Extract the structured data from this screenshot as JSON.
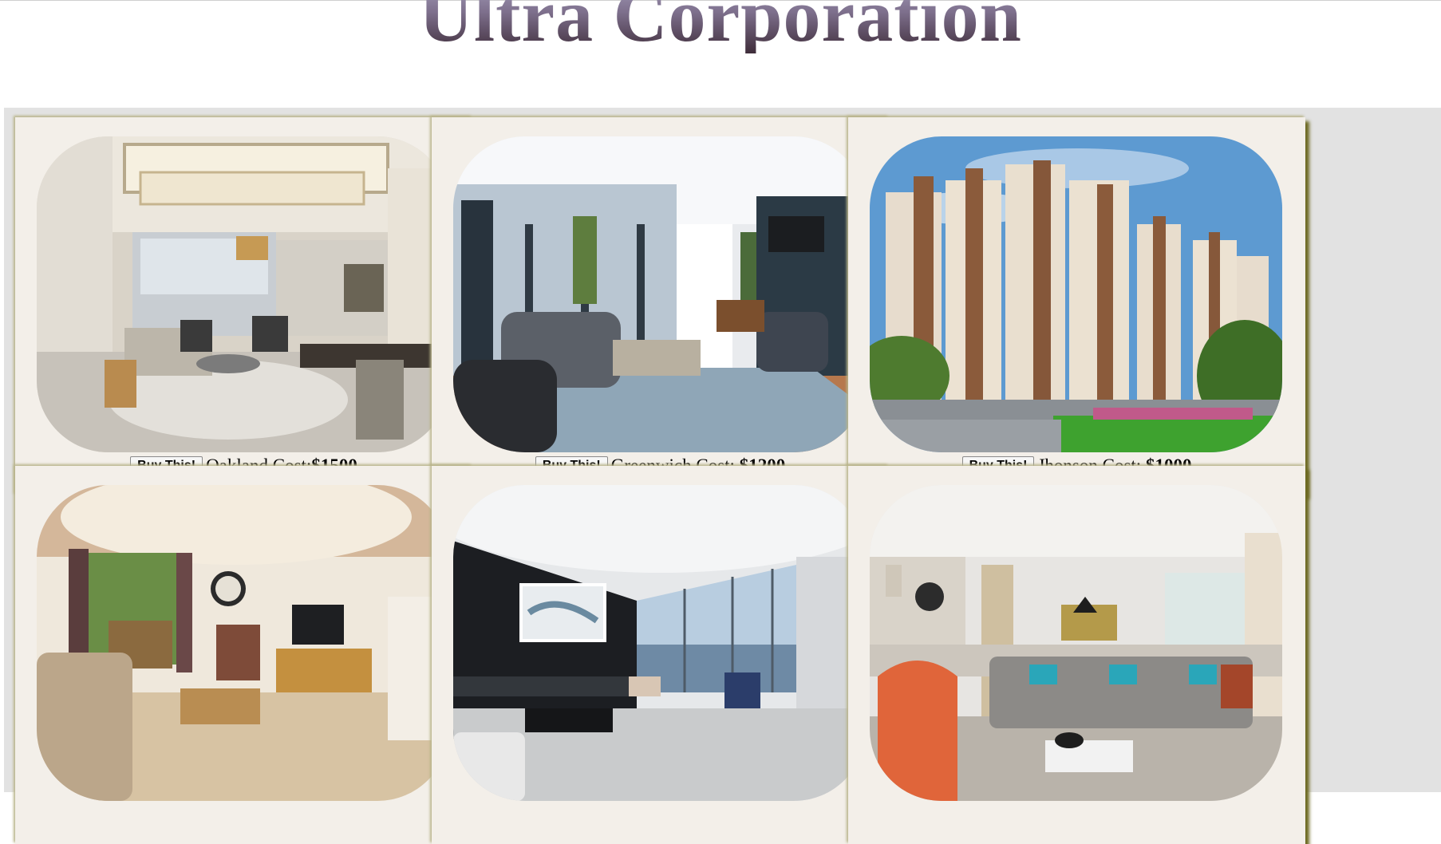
{
  "header": {
    "title": "Ultra Corporation"
  },
  "listings": [
    {
      "name": "Oakland",
      "cost_label": "Cost:",
      "price": "$1500",
      "button": "Buy This!",
      "image": "luxury-living-room-photo"
    },
    {
      "name": "Greenwich",
      "cost_label": "Cost: ",
      "price": "$1200",
      "button": "Buy This!",
      "image": "modern-living-room-photo"
    },
    {
      "name": "Jhonson",
      "cost_label": "Cost: ",
      "price": "$1000",
      "button": "Buy This!",
      "image": "apartment-towers-photo"
    },
    {
      "name": "",
      "cost_label": "",
      "price": "",
      "button": "",
      "image": "cozy-living-room-photo"
    },
    {
      "name": "",
      "cost_label": "",
      "price": "",
      "button": "",
      "image": "city-view-lounge-photo"
    },
    {
      "name": "",
      "cost_label": "",
      "price": "",
      "button": "",
      "image": "orange-chair-living-room-photo"
    }
  ]
}
